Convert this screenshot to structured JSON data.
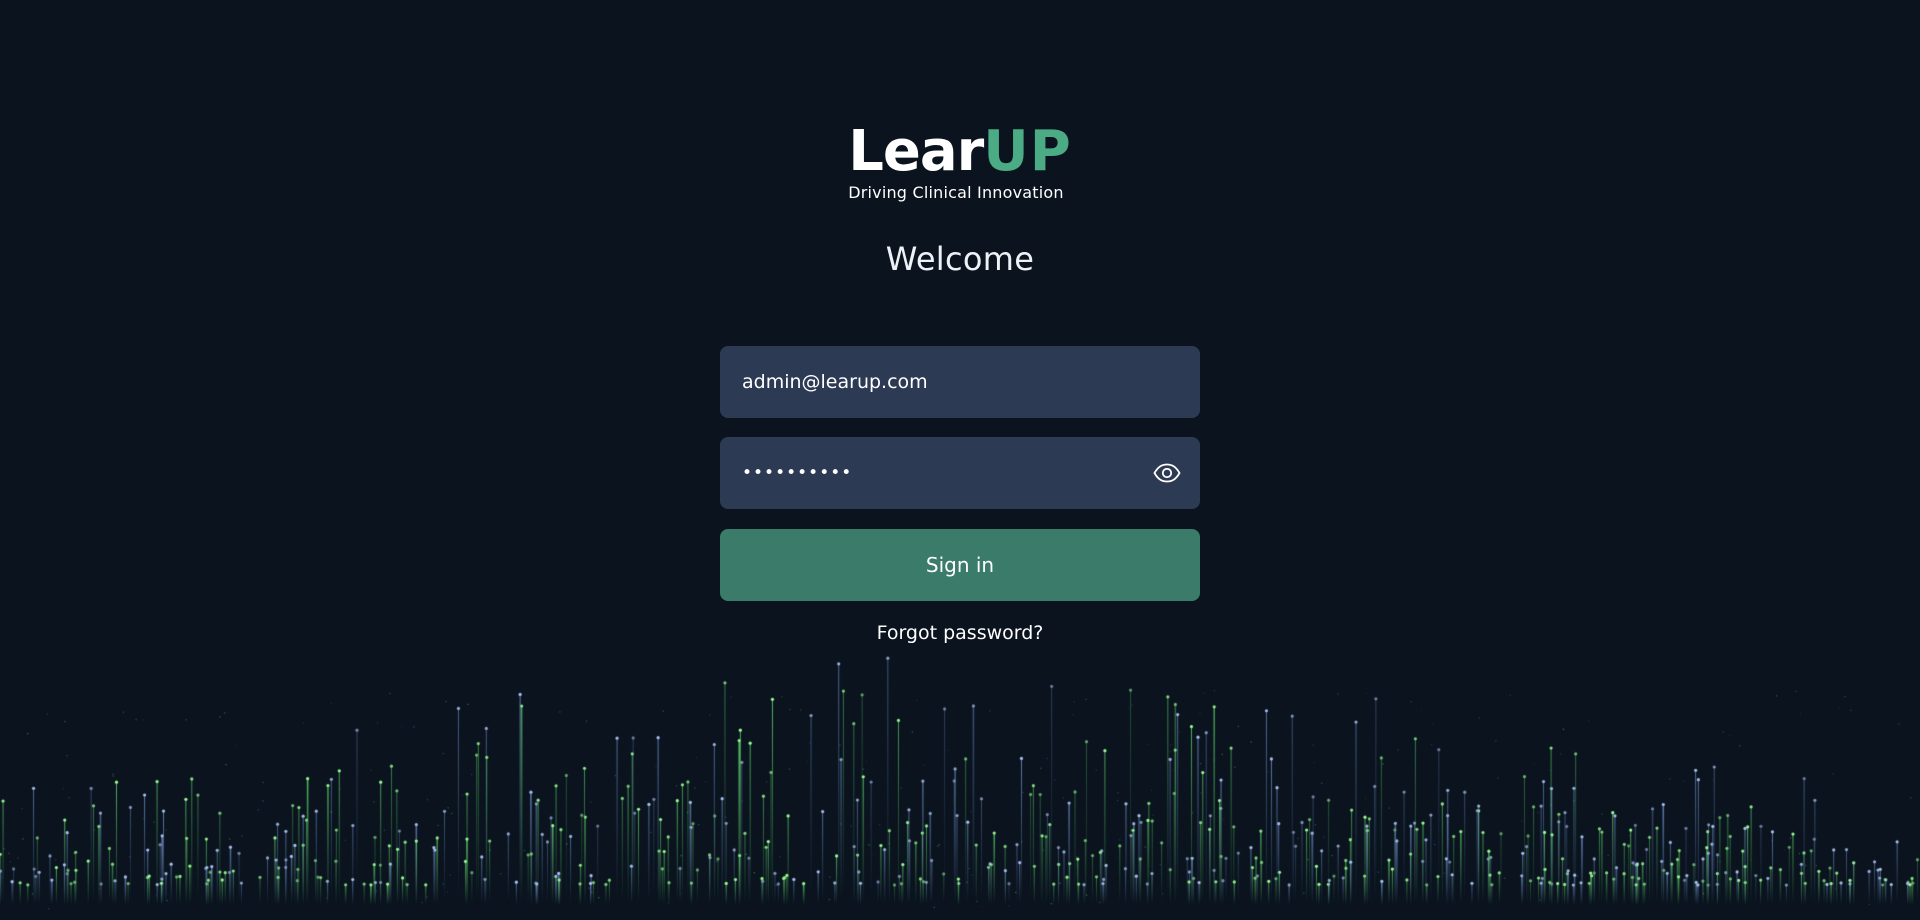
{
  "brand": {
    "name_part1": "Lear",
    "name_part2": "UP",
    "tagline": "Driving Clinical Innovation",
    "accent_color": "#4aab84"
  },
  "welcome_heading": "Welcome",
  "login_form": {
    "email_value": "admin@learup.com",
    "password_value": "••••••••••",
    "show_password_icon": "eye-icon",
    "submit_label": "Sign in",
    "forgot_password_label": "Forgot password?"
  },
  "colors": {
    "background": "#0a131e",
    "input_background": "#2d3a53",
    "button_background": "#3a7b6a",
    "particle_green": "#5fd06a",
    "particle_blue": "#6f90c8"
  }
}
